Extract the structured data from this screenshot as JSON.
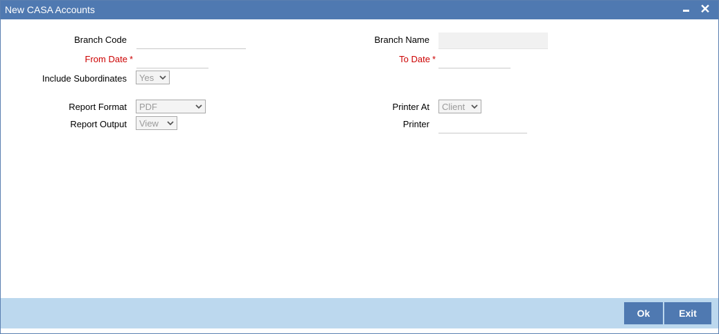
{
  "window": {
    "title": "New CASA Accounts",
    "minimize_icon": "minimize-icon",
    "close_icon": "close-icon",
    "close_glyph": "✕"
  },
  "form": {
    "branch_code": {
      "label": "Branch Code",
      "value": ""
    },
    "branch_name": {
      "label": "Branch Name",
      "value": ""
    },
    "from_date": {
      "label": "From Date",
      "required_mark": "*",
      "value": ""
    },
    "to_date": {
      "label": "To Date",
      "required_mark": "*",
      "value": ""
    },
    "include_subordinates": {
      "label": "Include Subordinates",
      "value": "Yes"
    },
    "report_format": {
      "label": "Report Format",
      "value": "PDF"
    },
    "report_output": {
      "label": "Report Output",
      "value": "View"
    },
    "printer_at": {
      "label": "Printer At",
      "value": "Client"
    },
    "printer": {
      "label": "Printer",
      "value": ""
    }
  },
  "footer": {
    "ok_label": "Ok",
    "exit_label": "Exit"
  },
  "colors": {
    "titlebar": "#4f79b1",
    "footer": "#bcd8ee",
    "required": "#cc0000"
  }
}
